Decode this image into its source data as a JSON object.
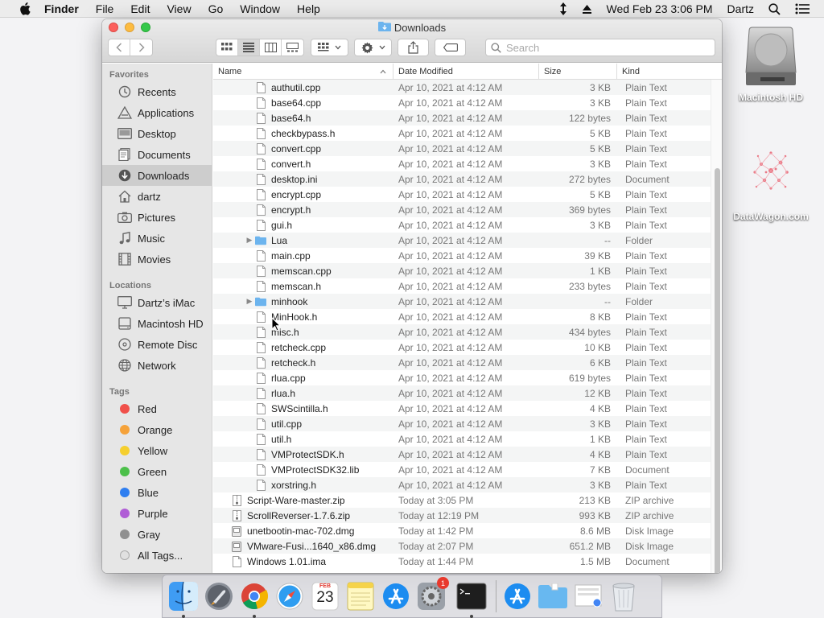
{
  "menubar": {
    "app": "Finder",
    "items": [
      "File",
      "Edit",
      "View",
      "Go",
      "Window",
      "Help"
    ],
    "clock": "Wed Feb 23  3:06 PM",
    "user": "Dartz"
  },
  "window": {
    "title": "Downloads",
    "search_placeholder": "Search"
  },
  "sidebar": {
    "favorites_header": "Favorites",
    "favorites": [
      {
        "label": "Recents"
      },
      {
        "label": "Applications"
      },
      {
        "label": "Desktop"
      },
      {
        "label": "Documents"
      },
      {
        "label": "Downloads"
      },
      {
        "label": "dartz"
      },
      {
        "label": "Pictures"
      },
      {
        "label": "Music"
      },
      {
        "label": "Movies"
      }
    ],
    "locations_header": "Locations",
    "locations": [
      {
        "label": "Dartz’s iMac"
      },
      {
        "label": "Macintosh HD"
      },
      {
        "label": "Remote Disc"
      },
      {
        "label": "Network"
      }
    ],
    "tags_header": "Tags",
    "tags": [
      {
        "label": "Red",
        "color": "#f0504a"
      },
      {
        "label": "Orange",
        "color": "#f5a23a"
      },
      {
        "label": "Yellow",
        "color": "#f5cf2e"
      },
      {
        "label": "Green",
        "color": "#4cc04a"
      },
      {
        "label": "Blue",
        "color": "#2f7ef0"
      },
      {
        "label": "Purple",
        "color": "#b05dd6"
      },
      {
        "label": "Gray",
        "color": "#909090"
      },
      {
        "label": "All Tags..."
      }
    ]
  },
  "columns": {
    "name": "Name",
    "date": "Date Modified",
    "size": "Size",
    "kind": "Kind"
  },
  "files": [
    {
      "name": "authutil.cpp",
      "date": "Apr 10, 2021 at 4:12 AM",
      "size": "3 KB",
      "kind": "Plain Text"
    },
    {
      "name": "base64.cpp",
      "date": "Apr 10, 2021 at 4:12 AM",
      "size": "3 KB",
      "kind": "Plain Text"
    },
    {
      "name": "base64.h",
      "date": "Apr 10, 2021 at 4:12 AM",
      "size": "122 bytes",
      "kind": "Plain Text"
    },
    {
      "name": "checkbypass.h",
      "date": "Apr 10, 2021 at 4:12 AM",
      "size": "5 KB",
      "kind": "Plain Text"
    },
    {
      "name": "convert.cpp",
      "date": "Apr 10, 2021 at 4:12 AM",
      "size": "5 KB",
      "kind": "Plain Text"
    },
    {
      "name": "convert.h",
      "date": "Apr 10, 2021 at 4:12 AM",
      "size": "3 KB",
      "kind": "Plain Text"
    },
    {
      "name": "desktop.ini",
      "date": "Apr 10, 2021 at 4:12 AM",
      "size": "272 bytes",
      "kind": "Document"
    },
    {
      "name": "encrypt.cpp",
      "date": "Apr 10, 2021 at 4:12 AM",
      "size": "5 KB",
      "kind": "Plain Text"
    },
    {
      "name": "encrypt.h",
      "date": "Apr 10, 2021 at 4:12 AM",
      "size": "369 bytes",
      "kind": "Plain Text"
    },
    {
      "name": "gui.h",
      "date": "Apr 10, 2021 at 4:12 AM",
      "size": "3 KB",
      "kind": "Plain Text"
    },
    {
      "name": "Lua",
      "date": "Apr 10, 2021 at 4:12 AM",
      "size": "--",
      "kind": "Folder",
      "folder": true
    },
    {
      "name": "main.cpp",
      "date": "Apr 10, 2021 at 4:12 AM",
      "size": "39 KB",
      "kind": "Plain Text"
    },
    {
      "name": "memscan.cpp",
      "date": "Apr 10, 2021 at 4:12 AM",
      "size": "1 KB",
      "kind": "Plain Text"
    },
    {
      "name": "memscan.h",
      "date": "Apr 10, 2021 at 4:12 AM",
      "size": "233 bytes",
      "kind": "Plain Text"
    },
    {
      "name": "minhook",
      "date": "Apr 10, 2021 at 4:12 AM",
      "size": "--",
      "kind": "Folder",
      "folder": true
    },
    {
      "name": "MinHook.h",
      "date": "Apr 10, 2021 at 4:12 AM",
      "size": "8 KB",
      "kind": "Plain Text"
    },
    {
      "name": "misc.h",
      "date": "Apr 10, 2021 at 4:12 AM",
      "size": "434 bytes",
      "kind": "Plain Text"
    },
    {
      "name": "retcheck.cpp",
      "date": "Apr 10, 2021 at 4:12 AM",
      "size": "10 KB",
      "kind": "Plain Text"
    },
    {
      "name": "retcheck.h",
      "date": "Apr 10, 2021 at 4:12 AM",
      "size": "6 KB",
      "kind": "Plain Text"
    },
    {
      "name": "rlua.cpp",
      "date": "Apr 10, 2021 at 4:12 AM",
      "size": "619 bytes",
      "kind": "Plain Text"
    },
    {
      "name": "rlua.h",
      "date": "Apr 10, 2021 at 4:12 AM",
      "size": "12 KB",
      "kind": "Plain Text"
    },
    {
      "name": "SWScintilla.h",
      "date": "Apr 10, 2021 at 4:12 AM",
      "size": "4 KB",
      "kind": "Plain Text"
    },
    {
      "name": "util.cpp",
      "date": "Apr 10, 2021 at 4:12 AM",
      "size": "3 KB",
      "kind": "Plain Text"
    },
    {
      "name": "util.h",
      "date": "Apr 10, 2021 at 4:12 AM",
      "size": "1 KB",
      "kind": "Plain Text"
    },
    {
      "name": "VMProtectSDK.h",
      "date": "Apr 10, 2021 at 4:12 AM",
      "size": "4 KB",
      "kind": "Plain Text"
    },
    {
      "name": "VMProtectSDK32.lib",
      "date": "Apr 10, 2021 at 4:12 AM",
      "size": "7 KB",
      "kind": "Document"
    },
    {
      "name": "xorstring.h",
      "date": "Apr 10, 2021 at 4:12 AM",
      "size": "3 KB",
      "kind": "Plain Text"
    },
    {
      "name": "Script-Ware-master.zip",
      "date": "Today at 3:05 PM",
      "size": "213 KB",
      "kind": "ZIP archive",
      "top": true,
      "icon": "zip"
    },
    {
      "name": "ScrollReverser-1.7.6.zip",
      "date": "Today at 12:19 PM",
      "size": "993 KB",
      "kind": "ZIP archive",
      "top": true,
      "icon": "zip"
    },
    {
      "name": "unetbootin-mac-702.dmg",
      "date": "Today at 1:42 PM",
      "size": "8.6 MB",
      "kind": "Disk Image",
      "top": true,
      "icon": "dmg"
    },
    {
      "name": "VMware-Fusi...1640_x86.dmg",
      "date": "Today at 2:07 PM",
      "size": "651.2 MB",
      "kind": "Disk Image",
      "top": true,
      "icon": "dmg"
    },
    {
      "name": "Windows 1.01.ima",
      "date": "Today at 1:44 PM",
      "size": "1.5 MB",
      "kind": "Document",
      "top": true
    }
  ],
  "desktop": {
    "hd_label": "Macintosh HD",
    "datawagon_label": "DataWagon.com"
  },
  "dock": {
    "items": [
      "Finder",
      "Launchpad",
      "Chrome",
      "Safari",
      "Calendar",
      "Notes",
      "App Store",
      "System Preferences",
      "Terminal",
      "Applications",
      "Downloads",
      "Screenshot",
      "Trash"
    ],
    "calendar_month": "FEB",
    "calendar_day": "23",
    "badge": "1"
  }
}
